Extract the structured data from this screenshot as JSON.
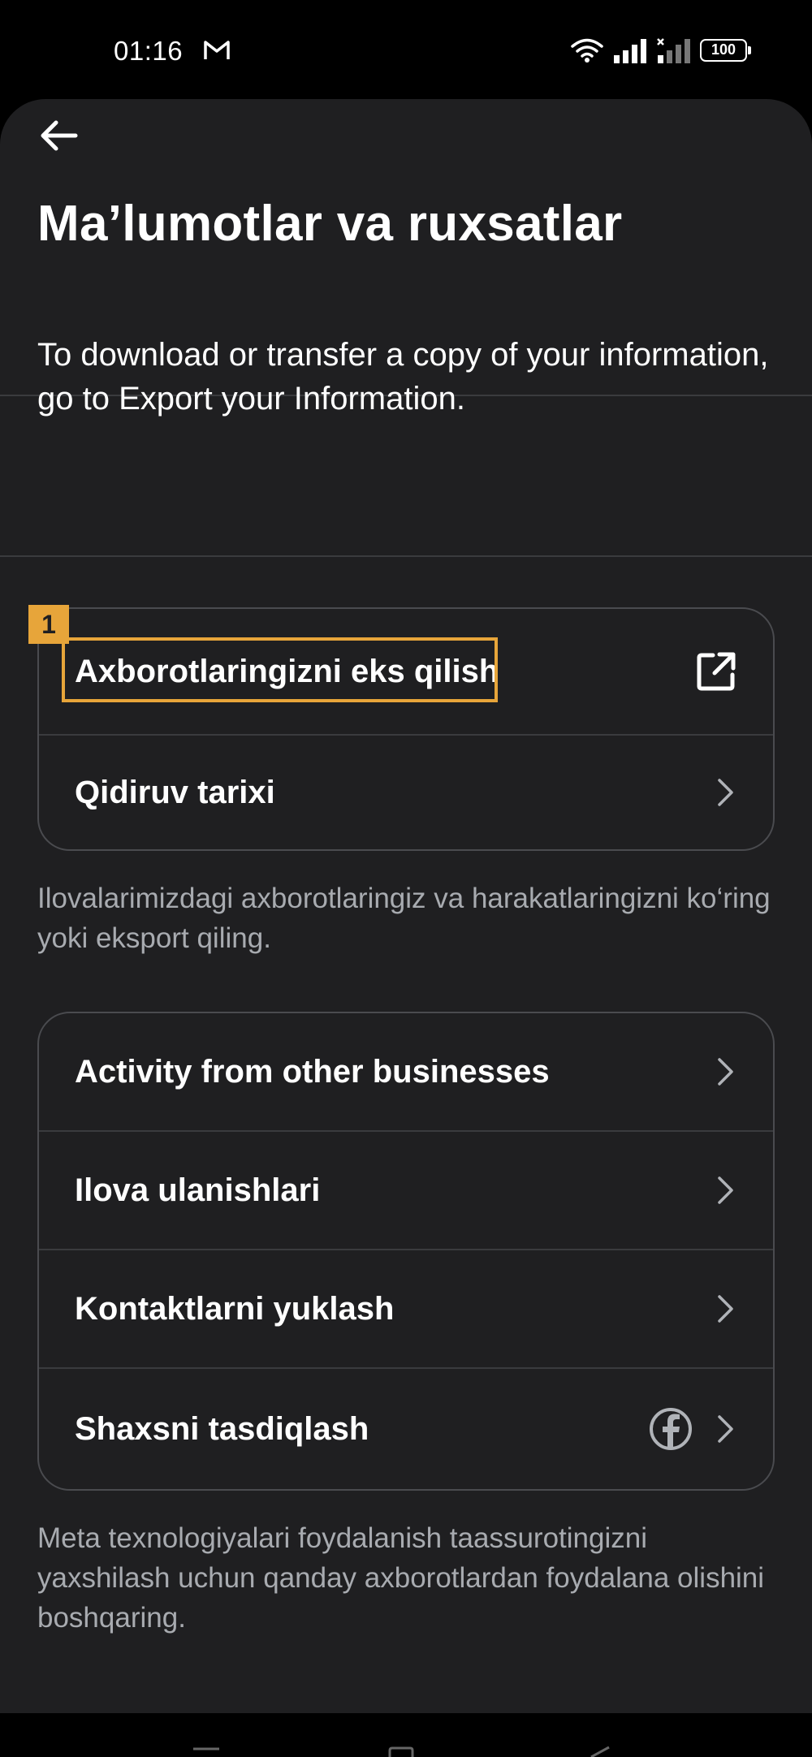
{
  "status_bar": {
    "time": "01:16",
    "battery": "100",
    "icons": [
      "gmail-icon",
      "wifi-icon",
      "signal-icon",
      "signal-no-service-icon",
      "battery-icon"
    ]
  },
  "header": {
    "back_icon": "arrow-left-icon",
    "title": "Ma’lumotlar va ruxsatlar"
  },
  "intro": "To download or transfer a copy of your information, go to Export your Information.",
  "section1": {
    "items": [
      {
        "label": "Axborotlaringizni eks qilish",
        "icon": "external-link-icon"
      },
      {
        "label": "Qidiruv tarixi",
        "icon": "chevron-right-icon"
      }
    ],
    "caption": "Ilovalarimizdagi axborotlaringiz va harakatlaringizni ko‘ring yoki eksport qiling."
  },
  "section2": {
    "items": [
      {
        "label": "Activity from other businesses",
        "icon": "chevron-right-icon"
      },
      {
        "label": "Ilova ulanishlari",
        "icon": "chevron-right-icon"
      },
      {
        "label": "Kontaktlarni yuklash",
        "icon": "chevron-right-icon"
      },
      {
        "label": "Shaxsni tasdiqlash",
        "icon": "chevron-right-icon",
        "extra_icon": "facebook-icon"
      }
    ],
    "caption": "Meta texnologiyalari foydalanish taassurotingizni yaxshilash uchun qanday axborotlardan foydalana olishini boshqaring."
  },
  "annotation": {
    "tag": "1",
    "color": "#e7a53a"
  },
  "colors": {
    "sheet_bg": "#1f1f21",
    "border": "#4a4b4f",
    "caption": "#a8abb0"
  }
}
